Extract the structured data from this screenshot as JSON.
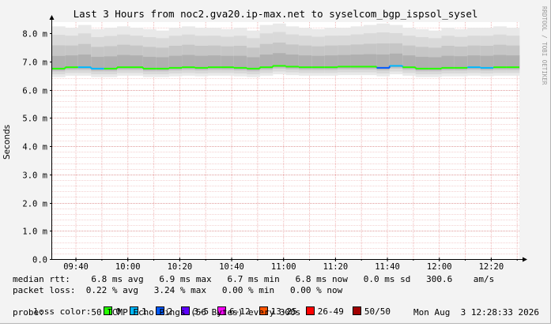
{
  "chart_data": {
    "type": "area",
    "title": "Last 3 Hours from noc2.gva20.ip-max.net to syselcom_bgp_ispsol_sysel",
    "ylabel": "Seconds",
    "credit": "RRDTOOL / TOBI OETIKER",
    "ylim": [
      0,
      8.4
    ],
    "y_ticks": [
      {
        "value": 0,
        "label": "0.0"
      },
      {
        "value": 1,
        "label": "1.0 m"
      },
      {
        "value": 2,
        "label": "2.0 m"
      },
      {
        "value": 3,
        "label": "3.0 m"
      },
      {
        "value": 4,
        "label": "4.0 m"
      },
      {
        "value": 5,
        "label": "5.0 m"
      },
      {
        "value": 6,
        "label": "6.0 m"
      },
      {
        "value": 7,
        "label": "7.0 m"
      },
      {
        "value": 8,
        "label": "8.0 m"
      }
    ],
    "x_range": [
      "09:31",
      "12:31"
    ],
    "x_ticks": [
      "09:40",
      "10:00",
      "10:20",
      "10:40",
      "11:00",
      "11:20",
      "11:40",
      "12:00",
      "12:20"
    ],
    "x_minute_ticks": [
      "09:40",
      "09:50",
      "10:00",
      "10:10",
      "10:20",
      "10:30",
      "10:40",
      "10:50",
      "11:00",
      "11:10",
      "11:20",
      "11:30",
      "11:40",
      "11:50",
      "12:00",
      "12:10",
      "12:20",
      "12:30"
    ],
    "grid": true,
    "series": [
      {
        "name": "median rtt",
        "x": [
          "09:31",
          "09:36",
          "09:41",
          "09:46",
          "09:51",
          "09:56",
          "10:01",
          "10:06",
          "10:11",
          "10:16",
          "10:21",
          "10:26",
          "10:31",
          "10:36",
          "10:41",
          "10:46",
          "10:51",
          "10:56",
          "11:01",
          "11:06",
          "11:11",
          "11:16",
          "11:21",
          "11:26",
          "11:31",
          "11:36",
          "11:41",
          "11:46",
          "11:51",
          "11:56",
          "12:01",
          "12:06",
          "12:11",
          "12:16",
          "12:21",
          "12:26"
        ],
        "values": [
          6.75,
          6.8,
          6.8,
          6.75,
          6.75,
          6.8,
          6.8,
          6.75,
          6.75,
          6.78,
          6.8,
          6.78,
          6.8,
          6.8,
          6.78,
          6.75,
          6.8,
          6.85,
          6.82,
          6.8,
          6.8,
          6.8,
          6.82,
          6.82,
          6.82,
          6.78,
          6.85,
          6.8,
          6.75,
          6.75,
          6.78,
          6.78,
          6.8,
          6.78,
          6.8,
          6.8
        ],
        "loss": [
          0,
          0,
          1,
          1,
          0,
          0,
          0,
          0,
          0,
          0,
          0,
          0,
          0,
          0,
          0,
          0,
          0,
          0,
          0,
          0,
          0,
          0,
          0,
          0,
          0,
          2,
          1,
          0,
          0,
          0,
          0,
          0,
          1,
          1,
          0,
          0
        ],
        "smoke_max": [
          8.25,
          8.2,
          8.3,
          8.15,
          8.2,
          8.25,
          8.2,
          8.15,
          8.1,
          8.2,
          8.25,
          8.2,
          8.2,
          8.15,
          8.2,
          8.1,
          8.3,
          8.35,
          8.25,
          8.2,
          8.15,
          8.2,
          8.2,
          8.25,
          8.3,
          8.35,
          8.3,
          8.2,
          8.15,
          8.1,
          8.2,
          8.15,
          8.2,
          8.2,
          8.25,
          8.2
        ]
      }
    ],
    "legend": {
      "median_rtt": "median rtt:    6.8 ms avg   6.9 ms max   6.7 ms min   6.8 ms now   0.0 ms sd   300.6    am/s",
      "packet_loss": "packet loss:  0.22 % avg   3.24 % max   0.00 % min   0.00 % now",
      "loss_color_label": "loss color:",
      "loss_colors": [
        {
          "label": "0",
          "color": "#26ff00"
        },
        {
          "label": "1",
          "color": "#00b8ff"
        },
        {
          "label": "2",
          "color": "#0059ff"
        },
        {
          "label": "3-5",
          "color": "#5e00ff"
        },
        {
          "label": "6-12",
          "color": "#ff00ff"
        },
        {
          "label": "13-25",
          "color": "#ff5500"
        },
        {
          "label": "26-49",
          "color": "#ff0000"
        },
        {
          "label": "50/50",
          "color": "#a10000"
        }
      ],
      "probe": "probe:         50 ICMP Echo Pings (56 Bytes) every 300s",
      "date": "Mon Aug  3 12:28:33 2026"
    }
  }
}
